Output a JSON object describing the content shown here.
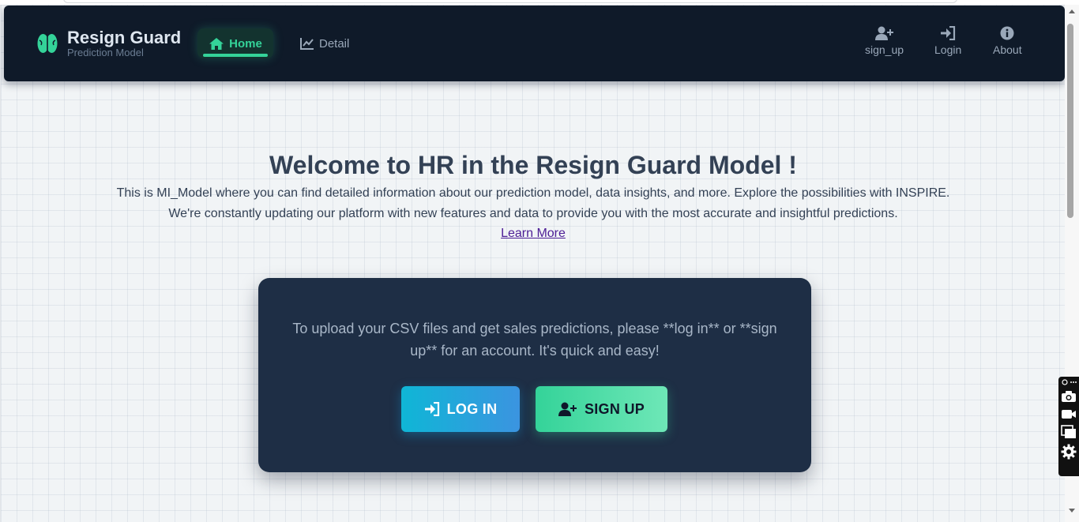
{
  "navbar": {
    "brand_name": "Resign Guard",
    "brand_subtitle": "Prediction Model",
    "brand_icon": "brain-icon",
    "links": [
      {
        "label": "Home",
        "icon": "home-icon",
        "active": true
      },
      {
        "label": "Detail",
        "icon": "chart-line-icon",
        "active": false
      }
    ],
    "right_links": [
      {
        "label": "sign_up",
        "icon": "user-plus-icon"
      },
      {
        "label": "Login",
        "icon": "sign-in-icon"
      },
      {
        "label": "About",
        "icon": "info-icon"
      }
    ]
  },
  "hero": {
    "title": "Welcome to HR in the Resign Guard Model !",
    "line1": "This is MI_Model where you can find detailed information about our prediction model, data insights, and more. Explore the possibilities with INSPIRE.",
    "line2": "We're constantly updating our platform with new features and data to provide you with the most accurate and insightful predictions.",
    "link": "Learn More"
  },
  "card": {
    "message": "To upload your CSV files and get sales predictions, please **log in** or **sign up** for an account. It's quick and easy!",
    "login_label": "LOG IN",
    "signup_label": "SIGN UP"
  },
  "dock": {
    "items": [
      "screenshot-icon",
      "camera-icon",
      "video-icon",
      "windows-icon",
      "gear-icon"
    ]
  },
  "colors": {
    "navbar_bg": "#0f1a29",
    "accent_green": "#34d399",
    "card_bg": "#1e2e45",
    "login_gradient": [
      "#0fb6d6",
      "#3b94e0"
    ],
    "signup_gradient": [
      "#34d399",
      "#6ee7b7"
    ]
  }
}
